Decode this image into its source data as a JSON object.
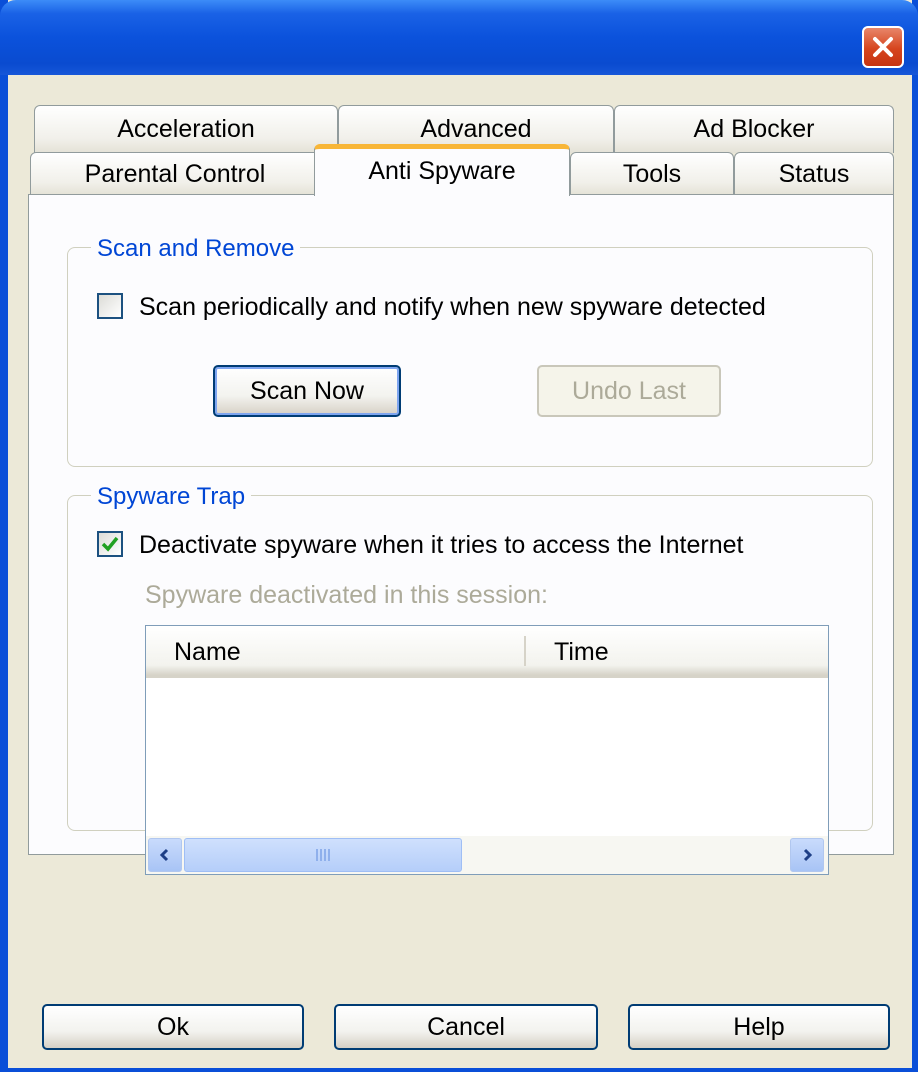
{
  "window": {
    "title": ""
  },
  "tabs": {
    "row1": [
      {
        "label": "Acceleration"
      },
      {
        "label": "Advanced"
      },
      {
        "label": "Ad Blocker"
      }
    ],
    "row2": [
      {
        "label": "Parental Control"
      },
      {
        "label": "Anti Spyware",
        "active": true
      },
      {
        "label": "Tools"
      },
      {
        "label": "Status"
      }
    ]
  },
  "scan_group": {
    "title": "Scan and Remove",
    "periodic_checkbox": {
      "label": "Scan periodically and notify when new spyware detected",
      "checked": false
    },
    "scan_now_label": "Scan Now",
    "undo_last_label": "Undo Last"
  },
  "trap_group": {
    "title": "Spyware Trap",
    "deactivate_checkbox": {
      "label": "Deactivate spyware when it tries to access the Internet",
      "checked": true
    },
    "session_label": "Spyware deactivated in this session:",
    "list": {
      "columns": [
        "Name",
        "Time"
      ],
      "rows": []
    }
  },
  "footer": {
    "ok_label": "Ok",
    "cancel_label": "Cancel",
    "help_label": "Help"
  },
  "colors": {
    "titlebar": "#0a4fd8",
    "group_title": "#0046d5",
    "active_tab_accent": "#f8b637",
    "checkmark": "#21a121",
    "close_button": "#d6451e"
  }
}
